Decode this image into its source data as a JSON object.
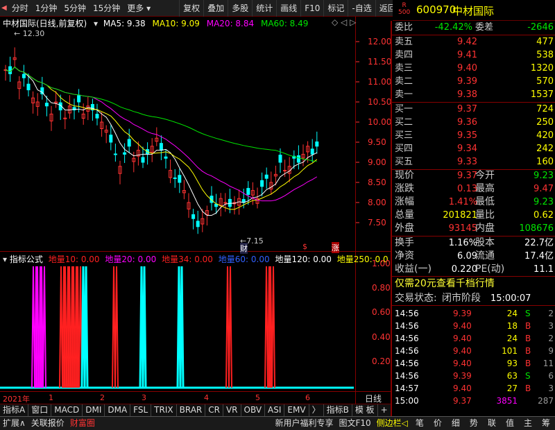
{
  "toolbar": {
    "left": [
      "分时",
      "1分钟",
      "5分钟",
      "15分钟",
      "更多"
    ],
    "right": [
      "复权",
      "叠加",
      "多股",
      "统计",
      "画线",
      "F10",
      "标记",
      "-自选",
      "返回"
    ]
  },
  "stock": {
    "code": "600970",
    "name": "中材国际",
    "rlabel": "R",
    "rsub": "500"
  },
  "chart": {
    "title": "中材国际(日线,前复权)",
    "ma5": "MA5: 9.38",
    "ma10": "MA10: 9.09",
    "ma20": "MA20: 8.84",
    "ma60": "MA60: 8.49",
    "high_label": "12.30",
    "low_label": "7.15",
    "mark_cai": "财",
    "mark_s": "$",
    "mark_zhang": "涨",
    "yticks": [
      "12.00",
      "11.50",
      "11.00",
      "10.50",
      "10.00",
      "9.50",
      "9.00",
      "8.50",
      "8.00",
      "7.50"
    ]
  },
  "indicator": {
    "title": "指标公式",
    "l10": "地量10: 0.00",
    "l20": "地量20: 0.00",
    "l34": "地量34: 0.00",
    "l60": "地量60: 0.00",
    "l120": "地量120: 0.00",
    "l250": "地量250: 0.0",
    "yticks": [
      "1.00",
      "0.80",
      "0.60",
      "0.40",
      "0.20"
    ]
  },
  "timeline": {
    "year": "2021年",
    "months": [
      "1",
      "2",
      "3",
      "4",
      "5",
      "6"
    ],
    "period": "日线"
  },
  "bottom_tabs": [
    "指标A",
    "窗口",
    "MACD",
    "DMI",
    "DMA",
    "FSL",
    "TRIX",
    "BRAR",
    "CR",
    "VR",
    "OBV",
    "ASI",
    "EMV",
    "〉",
    "指标B",
    "模 板",
    "+",
    "-"
  ],
  "status": [
    "扩展∧",
    "关联报价",
    "财富圈"
  ],
  "status_right": [
    "新用户福利专享",
    "图文F10",
    "侧边栏◁"
  ],
  "status_icons": [
    "笔",
    "价",
    "细",
    "势",
    "联",
    "值",
    "主",
    "筹"
  ],
  "quote": {
    "weibi": {
      "label": "委比",
      "value": "-42.42%",
      "label2": "委差",
      "value2": "-2646"
    },
    "sells": [
      {
        "label": "卖五",
        "price": "9.42",
        "vol": "477"
      },
      {
        "label": "卖四",
        "price": "9.41",
        "vol": "538"
      },
      {
        "label": "卖三",
        "price": "9.40",
        "vol": "1320"
      },
      {
        "label": "卖二",
        "price": "9.39",
        "vol": "570"
      },
      {
        "label": "卖一",
        "price": "9.38",
        "vol": "1537"
      }
    ],
    "buys": [
      {
        "label": "买一",
        "price": "9.37",
        "vol": "724"
      },
      {
        "label": "买二",
        "price": "9.36",
        "vol": "250"
      },
      {
        "label": "买三",
        "price": "9.35",
        "vol": "420"
      },
      {
        "label": "买四",
        "price": "9.34",
        "vol": "242"
      },
      {
        "label": "买五",
        "price": "9.33",
        "vol": "160"
      }
    ],
    "stats": [
      {
        "l1": "现价",
        "v1": "9.37",
        "l2": "今开",
        "v2": "9.23"
      },
      {
        "l1": "涨跌",
        "v1": "0.13",
        "l2": "最高",
        "v2": "9.47"
      },
      {
        "l1": "涨幅",
        "v1": "1.41%",
        "l2": "最低",
        "v2": "9.23"
      },
      {
        "l1": "总量",
        "v1": "201821",
        "l2": "量比",
        "v2": "0.62"
      },
      {
        "l1": "外盘",
        "v1": "93145",
        "l2": "内盘",
        "v2": "108676"
      }
    ],
    "stats2": [
      {
        "l1": "换手",
        "v1": "1.16%",
        "l2": "股本",
        "v2": "22.7亿"
      },
      {
        "l1": "净资",
        "v1": "6.09",
        "l2": "流通",
        "v2": "17.4亿"
      },
      {
        "l1": "收益(一)",
        "v1": "0.220",
        "l2": "PE(动)",
        "v2": "11.1"
      }
    ],
    "promo": "仅需20元查看千档行情",
    "state_label": "交易状态:",
    "state_value": "闭市阶段",
    "state_time": "15:00:07",
    "ticks": [
      {
        "t": "14:56",
        "p": "9.39",
        "v": "24",
        "d": "S",
        "n": "2"
      },
      {
        "t": "14:56",
        "p": "9.40",
        "v": "18",
        "d": "B",
        "n": "3"
      },
      {
        "t": "14:56",
        "p": "9.40",
        "v": "24",
        "d": "B",
        "n": "2"
      },
      {
        "t": "14:56",
        "p": "9.40",
        "v": "101",
        "d": "B",
        "n": "9"
      },
      {
        "t": "14:56",
        "p": "9.40",
        "v": "93",
        "d": "B",
        "n": "11"
      },
      {
        "t": "14:56",
        "p": "9.39",
        "v": "63",
        "d": "S",
        "n": "6"
      },
      {
        "t": "14:57",
        "p": "9.40",
        "v": "27",
        "d": "B",
        "n": "3"
      },
      {
        "t": "15:00",
        "p": "9.37",
        "v": "3851",
        "d": "",
        "n": "287"
      }
    ]
  }
}
